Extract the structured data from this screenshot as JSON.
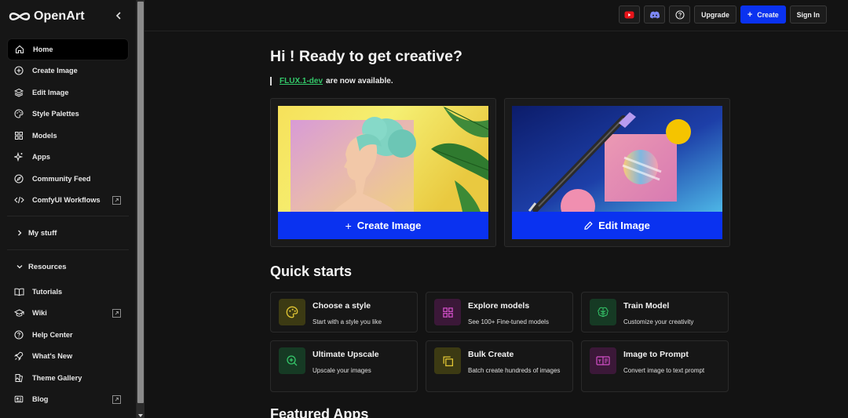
{
  "app": {
    "name": "OpenArt"
  },
  "sidebar": {
    "items": [
      {
        "label": "Home"
      },
      {
        "label": "Create Image"
      },
      {
        "label": "Edit Image"
      },
      {
        "label": "Style Palettes"
      },
      {
        "label": "Models"
      },
      {
        "label": "Apps"
      },
      {
        "label": "Community Feed"
      },
      {
        "label": "ComfyUI Workflows"
      }
    ],
    "my_stuff": "My stuff",
    "resources": {
      "label": "Resources",
      "items": [
        {
          "label": "Tutorials"
        },
        {
          "label": "Wiki"
        },
        {
          "label": "Help Center"
        },
        {
          "label": "What's New"
        },
        {
          "label": "Theme Gallery"
        },
        {
          "label": "Blog"
        }
      ]
    }
  },
  "topbar": {
    "upgrade": "Upgrade",
    "create": "Create",
    "sign_in": "Sign In"
  },
  "main": {
    "headline": "Hi ! Ready to get creative?",
    "notice": {
      "link": "FLUX.1-dev",
      "text": "are now available."
    },
    "hero": [
      {
        "label": "Create Image"
      },
      {
        "label": "Edit Image"
      }
    ],
    "quick_starts_title": "Quick starts",
    "quick_starts": [
      {
        "title": "Choose a style",
        "desc": "Start with a style you like"
      },
      {
        "title": "Explore models",
        "desc": "See 100+ Fine-tuned models"
      },
      {
        "title": "Train Model",
        "desc": "Customize your creativity"
      },
      {
        "title": "Ultimate Upscale",
        "desc": "Upscale your images"
      },
      {
        "title": "Bulk Create",
        "desc": "Batch create hundreds of images"
      },
      {
        "title": "Image to Prompt",
        "desc": "Convert image to text prompt"
      }
    ],
    "featured_apps_title": "Featured Apps"
  },
  "colors": {
    "accent": "#0a32f0",
    "link_green": "#33c96a",
    "youtube": "#e8141a",
    "discord": "#5865f2"
  }
}
